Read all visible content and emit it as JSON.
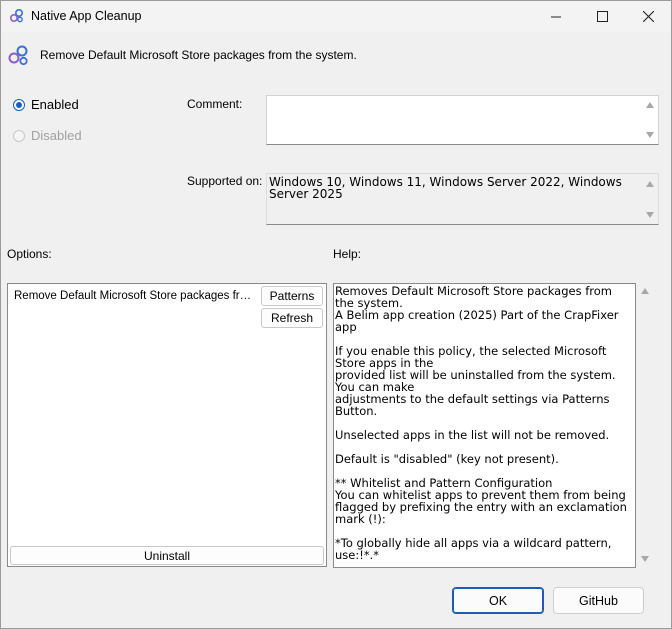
{
  "window": {
    "title": "Native App Cleanup",
    "controls": {
      "minimize": "minimize-icon",
      "maximize": "maximize-icon",
      "close": "close-icon"
    }
  },
  "header": {
    "description": "Remove Default Microsoft Store packages from the system."
  },
  "state": {
    "enabled_label": "Enabled",
    "disabled_label": "Disabled",
    "selected": "Enabled"
  },
  "comment": {
    "label": "Comment:",
    "value": ""
  },
  "supported": {
    "label": "Supported on:",
    "value": "Windows 10, Windows 11, Windows Server 2022, Windows Server 2025"
  },
  "options": {
    "label": "Options:",
    "item_label": "Remove Default Microsoft Store packages from the system.",
    "patterns_button": "Patterns",
    "refresh_button": "Refresh",
    "uninstall_button": "Uninstall"
  },
  "help": {
    "label": "Help:",
    "text": "Removes Default Microsoft Store packages from the system.\nA Belim app creation (2025) Part of the CrapFixer app\n\nIf you enable this policy, the selected Microsoft Store apps in the\nprovided list will be uninstalled from the system. You can make\nadjustments to the default settings via Patterns Button.\n\nUnselected apps in the list will not be removed.\n\nDefault is \"disabled\" (key not present).\n\n** Whitelist and Pattern Configuration\nYou can whitelist apps to prevent them from being flagged by prefixing the entry with an exclamation mark (!):\n\n*To globally hide all apps via a wildcard pattern, use:!*.*"
  },
  "buttons": {
    "ok": "OK",
    "github": "GitHub"
  },
  "colors": {
    "accent": "#1a5fb4",
    "window_bg": "#f0f0f0",
    "field_bg": "#ffffff"
  }
}
